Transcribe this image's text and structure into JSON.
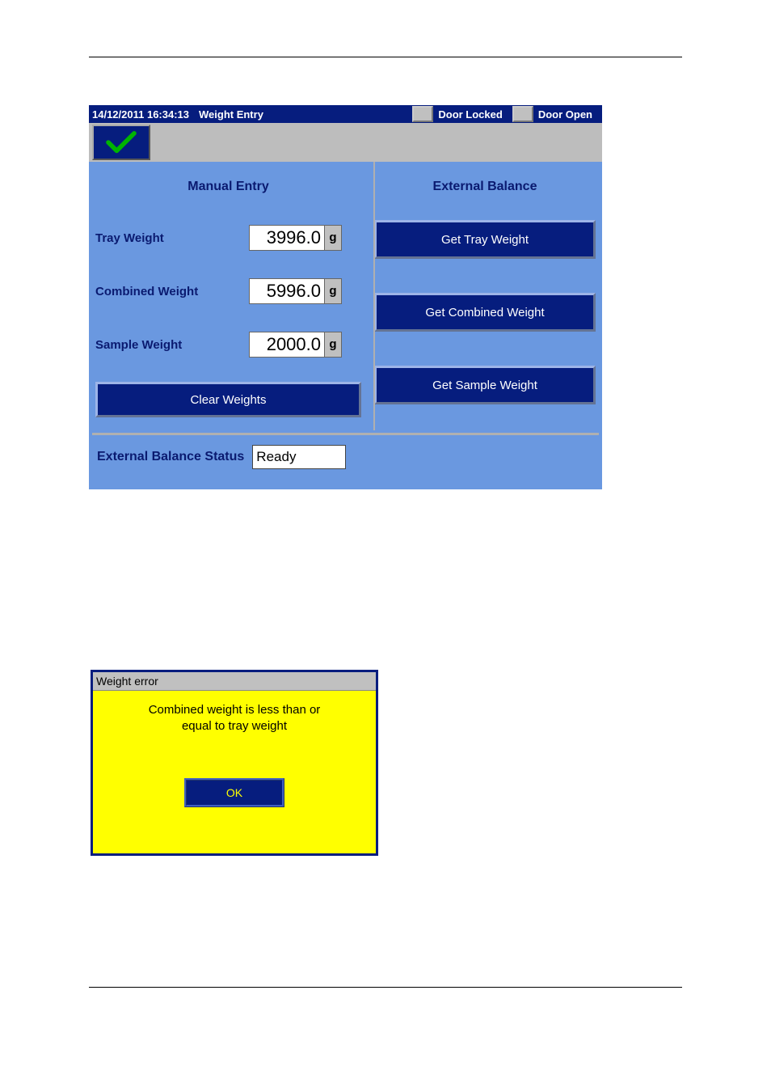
{
  "header": {
    "timestamp": "14/12/2011 16:34:13",
    "screen_title": "Weight Entry",
    "door_locked_label": "Door Locked",
    "door_open_label": "Door Open"
  },
  "sections": {
    "manual_entry": "Manual Entry",
    "external_balance": "External Balance"
  },
  "rows": {
    "tray": {
      "label": "Tray Weight",
      "value": "3996.0",
      "unit": "g"
    },
    "combined": {
      "label": "Combined Weight",
      "value": "5996.0",
      "unit": "g"
    },
    "sample": {
      "label": "Sample Weight",
      "value": "2000.0",
      "unit": "g"
    }
  },
  "buttons": {
    "get_tray": "Get Tray Weight",
    "get_combined": "Get Combined Weight",
    "get_sample": "Get Sample Weight",
    "clear": "Clear Weights"
  },
  "status": {
    "label": "External Balance Status",
    "value": "Ready"
  },
  "dialog": {
    "title": "Weight error",
    "message_line1": "Combined weight is less than or",
    "message_line2": "equal to tray weight",
    "ok": "OK"
  }
}
